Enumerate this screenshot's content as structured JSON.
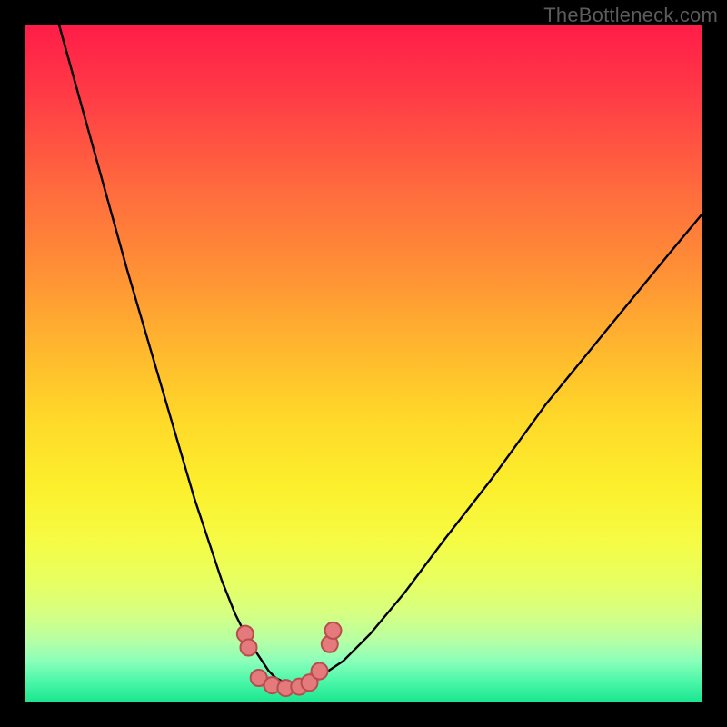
{
  "watermark": "TheBottleneck.com",
  "colors": {
    "frame": "#000000",
    "gradient_top": "#ff1d48",
    "gradient_bottom": "#1ce690",
    "curve": "#000000",
    "marker_fill": "#e47a7b",
    "marker_stroke": "#b84d4f"
  },
  "chart_data": {
    "type": "line",
    "title": "",
    "xlabel": "",
    "ylabel": "",
    "xlim": [
      0,
      100
    ],
    "ylim": [
      0,
      100
    ],
    "grid": false,
    "series": [
      {
        "name": "left-curve",
        "x": [
          5,
          10,
          15,
          20,
          25,
          27,
          29,
          31,
          33,
          35,
          36,
          37,
          38
        ],
        "values": [
          100,
          82,
          64,
          47,
          30,
          24,
          18,
          13,
          9,
          6,
          4.5,
          3.5,
          3
        ]
      },
      {
        "name": "right-curve",
        "x": [
          42,
          44,
          47,
          51,
          56,
          62,
          69,
          77,
          86,
          95,
          100
        ],
        "values": [
          3,
          4,
          6,
          10,
          16,
          24,
          33,
          44,
          55,
          66,
          72
        ]
      }
    ],
    "markers": [
      {
        "x": 32.5,
        "y": 10
      },
      {
        "x": 33,
        "y": 8
      },
      {
        "x": 34.5,
        "y": 3.5
      },
      {
        "x": 36.5,
        "y": 2.4
      },
      {
        "x": 38.5,
        "y": 2.0
      },
      {
        "x": 40.5,
        "y": 2.2
      },
      {
        "x": 42,
        "y": 2.8
      },
      {
        "x": 43.5,
        "y": 4.5
      },
      {
        "x": 45,
        "y": 8.5
      },
      {
        "x": 45.5,
        "y": 10.5
      }
    ],
    "spine": [
      {
        "x": 34.5,
        "y": 3.5
      },
      {
        "x": 36.5,
        "y": 2.4
      },
      {
        "x": 38.5,
        "y": 2.0
      },
      {
        "x": 40.5,
        "y": 2.2
      },
      {
        "x": 42,
        "y": 2.8
      },
      {
        "x": 43.5,
        "y": 4.5
      }
    ]
  }
}
